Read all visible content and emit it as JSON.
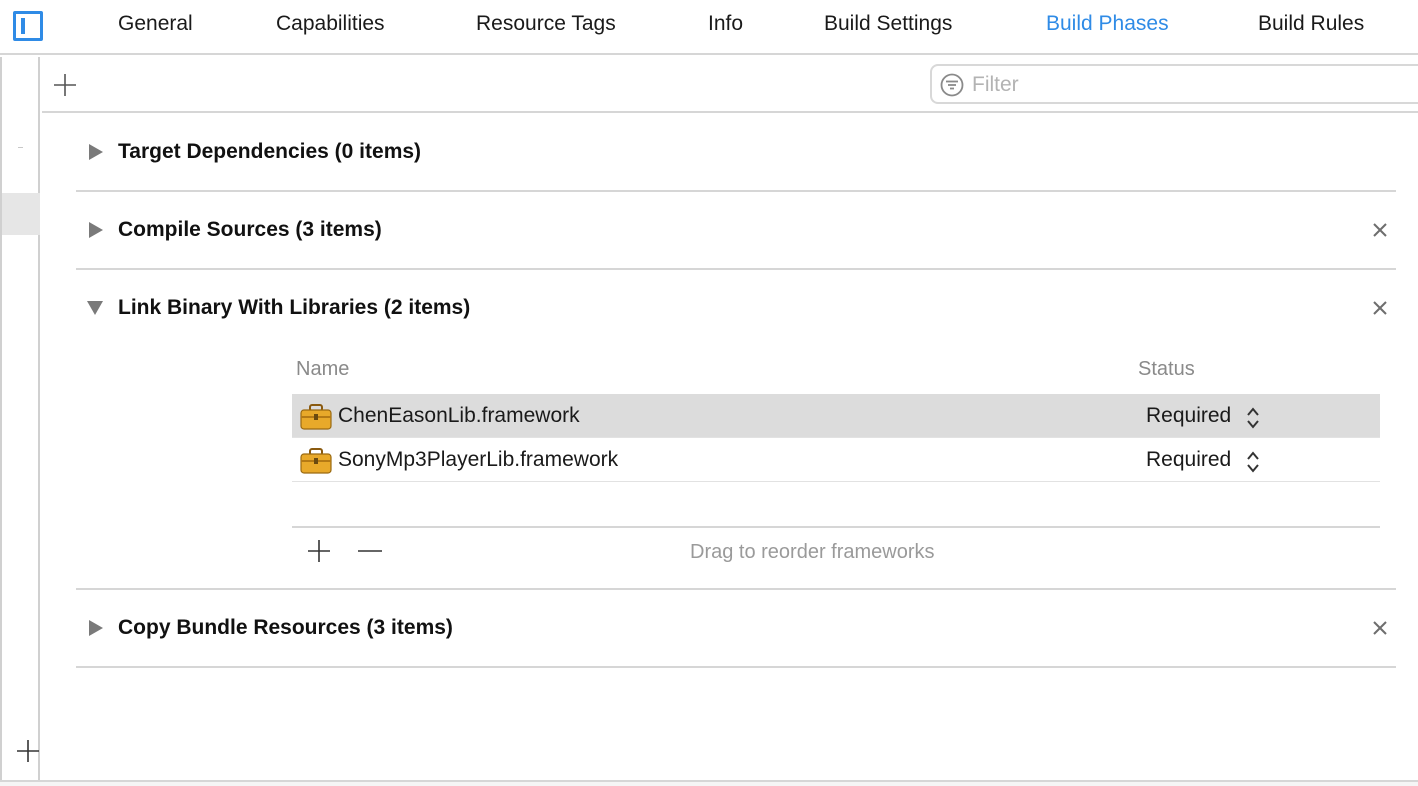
{
  "tabs": [
    {
      "label": "General",
      "active": false
    },
    {
      "label": "Capabilities",
      "active": false
    },
    {
      "label": "Resource Tags",
      "active": false
    },
    {
      "label": "Info",
      "active": false
    },
    {
      "label": "Build Settings",
      "active": false
    },
    {
      "label": "Build Phases",
      "active": true
    },
    {
      "label": "Build Rules",
      "active": false
    }
  ],
  "toolbar": {
    "add_icon": "plus-icon",
    "filter_placeholder": "Filter",
    "filter_value": ""
  },
  "phases": [
    {
      "title": "Target Dependencies (0 items)",
      "expanded": false,
      "removable": false
    },
    {
      "title": "Compile Sources (3 items)",
      "expanded": false,
      "removable": true
    },
    {
      "title": "Link Binary With Libraries (2 items)",
      "expanded": true,
      "removable": true,
      "columns": {
        "name": "Name",
        "status": "Status"
      },
      "libraries": [
        {
          "name": "ChenEasonLib.framework",
          "status": "Required",
          "selected": true
        },
        {
          "name": "SonyMp3PlayerLib.framework",
          "status": "Required",
          "selected": false
        }
      ],
      "footer_hint": "Drag to reorder frameworks"
    },
    {
      "title": "Copy Bundle Resources (3 items)",
      "expanded": false,
      "removable": true
    }
  ],
  "colors": {
    "accent": "#2f8be6",
    "separator": "#d6d6d6",
    "selected_row": "#dcdcdc",
    "framework_icon": "#e8a92a"
  }
}
